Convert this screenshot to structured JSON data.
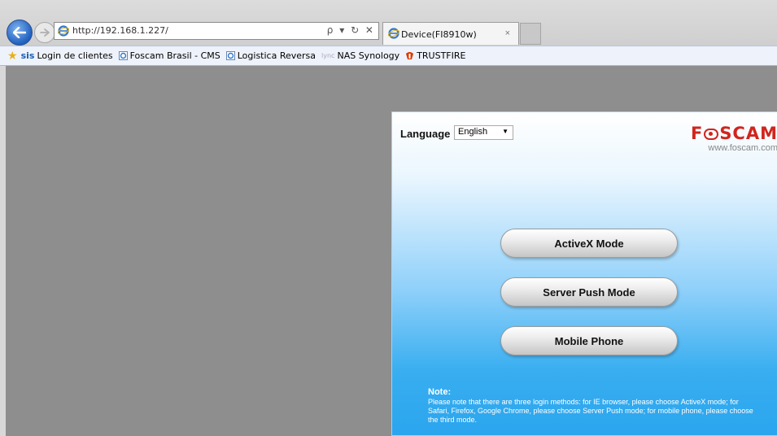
{
  "browser": {
    "url": "http://192.168.1.227/",
    "address_controls": "ρ ▾ ↻ ✕",
    "tab_title": "Device(FI8910w)",
    "tab_close": "×"
  },
  "favorites": [
    {
      "icon": "sis",
      "label": "Login de clientes"
    },
    {
      "icon": "ie-page-icon",
      "label": "Foscam Brasil - CMS"
    },
    {
      "icon": "ie-page-icon",
      "label": "Logistica Reversa"
    },
    {
      "icon": "lync",
      "label": "NAS Synology"
    },
    {
      "icon": "trustfire-icon",
      "label": "TRUSTFIRE"
    }
  ],
  "fav_icons": {
    "sis": "sis",
    "lync": "lync"
  },
  "login": {
    "language_label": "Language",
    "language_value": "English",
    "logo_pre": "F",
    "logo_post": "SCAM",
    "site": "www.foscam.com",
    "buttons": [
      "ActiveX Mode",
      "Server Push Mode",
      "Mobile Phone"
    ],
    "note_title": "Note:",
    "note_text": "Please note that there are three login methods: for IE browser, please choose ActiveX mode; for Safari, Firefox, Google Chrome, please choose Server Push mode; for mobile phone, please choose the third mode."
  },
  "colors": {
    "brand": "#d1251d",
    "panel_blue": "#2aa5ee",
    "page_bg": "#8e8e8e"
  }
}
